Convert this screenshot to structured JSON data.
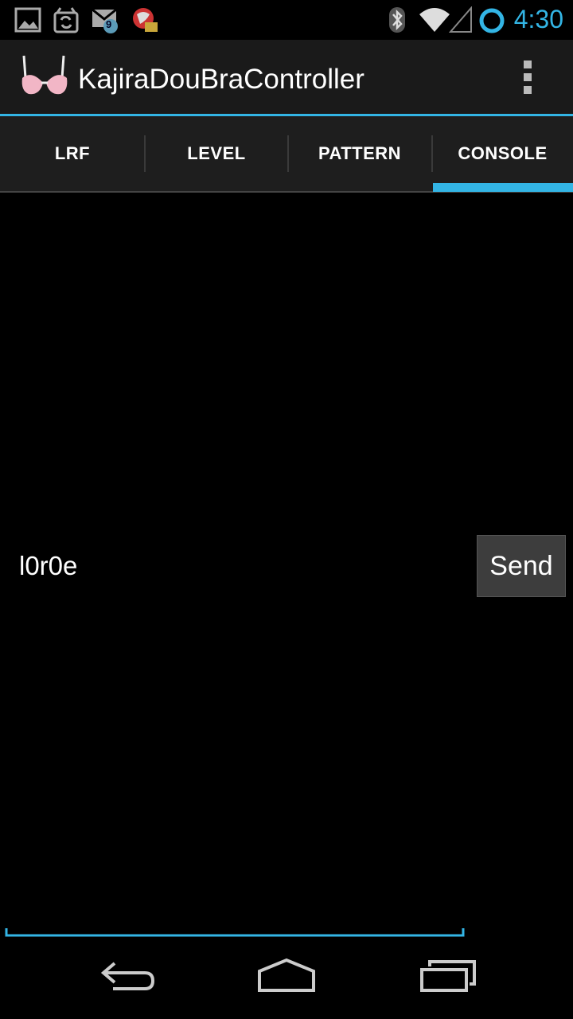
{
  "status_bar": {
    "time": "4:30",
    "left_icons": [
      "gallery-icon",
      "sync-icon",
      "email-icon",
      "hangouts-icon"
    ],
    "email_badge": "9",
    "right_icons": [
      "bluetooth-icon",
      "wifi-icon",
      "cellular-signal-icon",
      "battery-ring-icon"
    ]
  },
  "action_bar": {
    "title": "KajiraDouBraController",
    "app_icon": "bra-icon",
    "overflow_icon": "overflow-menu-icon"
  },
  "tabs": [
    {
      "label": "LRF",
      "selected": false
    },
    {
      "label": "LEVEL",
      "selected": false
    },
    {
      "label": "PATTERN",
      "selected": false
    },
    {
      "label": "CONSOLE",
      "selected": true
    }
  ],
  "console": {
    "output_text": "l0r0e",
    "send_label": "Send",
    "input_value": ""
  },
  "nav_bar": {
    "back_icon": "back-icon",
    "home_icon": "home-icon",
    "recents_icon": "recent-apps-icon"
  },
  "colors": {
    "accent": "#33b5e5",
    "action_bar_bg": "#1a1a1a",
    "tab_bar_bg": "#1e1e1e",
    "background": "#000000"
  }
}
